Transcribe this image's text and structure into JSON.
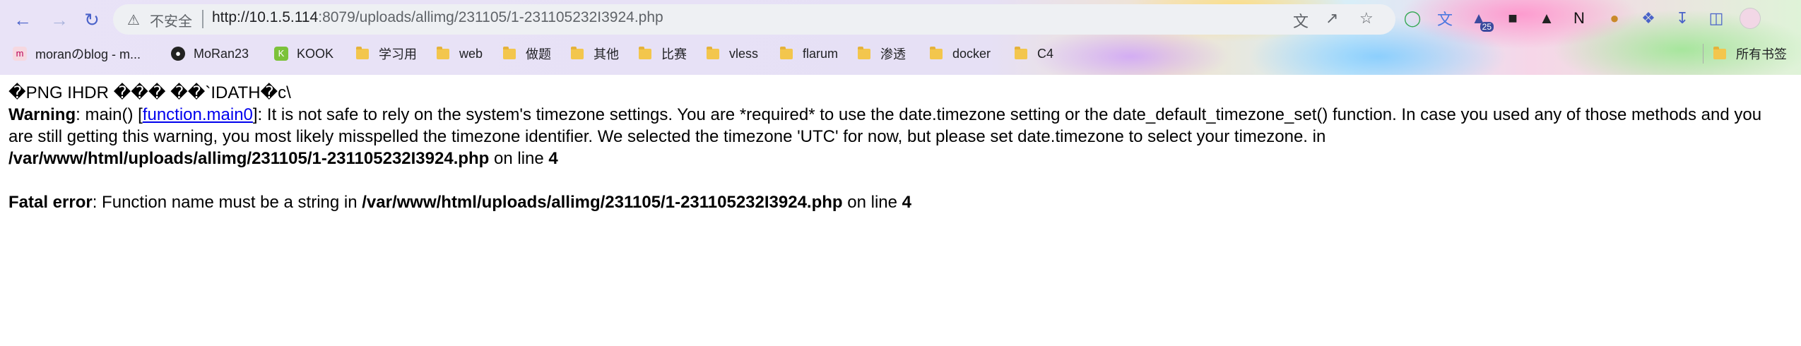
{
  "browser": {
    "security_label": "不安全",
    "url_host": "http://10.1.5.114",
    "url_rest": ":8079/uploads/allimg/231105/1-231105232I3924.php",
    "badge_count": "25"
  },
  "bookmarks": [
    {
      "label": "moranのblog - m...",
      "icon": "blog-favicon"
    },
    {
      "label": "MoRan23",
      "icon": "github-icon"
    },
    {
      "label": "KOOK",
      "icon": "kook-icon"
    },
    {
      "label": "学习用",
      "icon": "folder-icon"
    },
    {
      "label": "web",
      "icon": "folder-icon"
    },
    {
      "label": "做题",
      "icon": "folder-icon"
    },
    {
      "label": "其他",
      "icon": "folder-icon"
    },
    {
      "label": "比赛",
      "icon": "folder-icon"
    },
    {
      "label": "vless",
      "icon": "folder-icon"
    },
    {
      "label": "flarum",
      "icon": "folder-icon"
    },
    {
      "label": "渗透",
      "icon": "folder-icon"
    },
    {
      "label": "docker",
      "icon": "folder-icon"
    },
    {
      "label": "C4",
      "icon": "folder-icon"
    }
  ],
  "all_bookmarks": "所有书签",
  "page": {
    "garbage": "�PNG  IHDR  ��� ��`IDATH�c\\",
    "warning_label": "Warning",
    "warning_pre": ": main() [",
    "warning_link": "function.main0",
    "warning_text": "]: It is not safe to rely on the system's timezone settings. You are *required* to use the date.timezone setting or the date_default_timezone_set() function. In case you used any of those methods and you are still getting this warning, you most likely misspelled the timezone identifier. We selected the timezone 'UTC' for now, but please set date.timezone to select your timezone. in",
    "warning_path": "/var/www/html/uploads/allimg/231105/1-231105232I3924.php",
    "on_line": " on line ",
    "warning_line": "4",
    "fatal_label": "Fatal error",
    "fatal_text": ": Function name must be a string in ",
    "fatal_path": "/var/www/html/uploads/allimg/231105/1-231105232I3924.php",
    "fatal_line": "4"
  }
}
